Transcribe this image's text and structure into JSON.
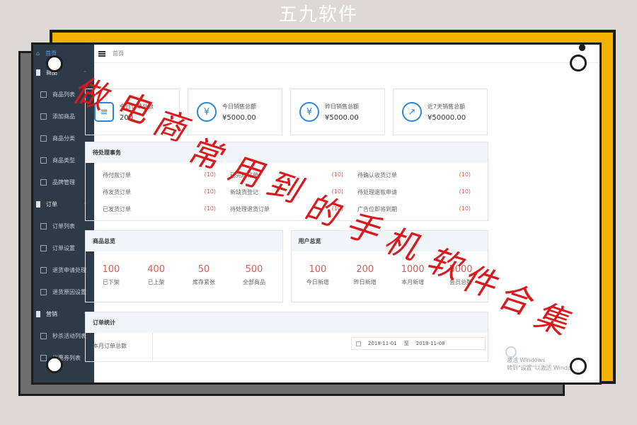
{
  "brand": "五九软件",
  "banner": "做电商常用到的手机软件合集",
  "topbar": {
    "breadcrumb": "首页"
  },
  "sidebar": {
    "home": "首页",
    "items": [
      {
        "kind": "group",
        "label": "商品"
      },
      {
        "kind": "item",
        "label": "商品列表"
      },
      {
        "kind": "item",
        "label": "添加商品"
      },
      {
        "kind": "item",
        "label": "商品分类"
      },
      {
        "kind": "item",
        "label": "商品类型"
      },
      {
        "kind": "item",
        "label": "品牌管理"
      },
      {
        "kind": "group",
        "label": "订单"
      },
      {
        "kind": "item",
        "label": "订单列表"
      },
      {
        "kind": "item",
        "label": "订单设置"
      },
      {
        "kind": "item",
        "label": "退货申请处理"
      },
      {
        "kind": "item",
        "label": "退货原因设置"
      },
      {
        "kind": "group",
        "label": "营销"
      },
      {
        "kind": "item",
        "label": "秒杀活动列表"
      },
      {
        "kind": "item",
        "label": "优惠券列表"
      }
    ]
  },
  "cards": [
    {
      "icon": "clipboard-icon",
      "glyph": "≡",
      "title": "今日订单总数",
      "value": "200"
    },
    {
      "icon": "yen-icon",
      "glyph": "¥",
      "title": "今日销售总额",
      "value": "¥5000.00"
    },
    {
      "icon": "coins-icon",
      "glyph": "¥",
      "title": "昨日销售总额",
      "value": "¥5000.00"
    },
    {
      "icon": "trend-chart-icon",
      "glyph": "↗",
      "title": "近7天销售总额",
      "value": "¥50000.00"
    }
  ],
  "pending": {
    "title": "待处理事务",
    "items": [
      {
        "label": "待付款订单",
        "count": "(10)"
      },
      {
        "label": "已完成订单",
        "count": "(10)"
      },
      {
        "label": "待确认收货订单",
        "count": "(10)"
      },
      {
        "label": "待发货订单",
        "count": "(10)"
      },
      {
        "label": "新缺货登记",
        "count": "(10)"
      },
      {
        "label": "待处理退款申请",
        "count": "(10)"
      },
      {
        "label": "已发货订单",
        "count": "(10)"
      },
      {
        "label": "待处理退货订单",
        "count": "(10)"
      },
      {
        "label": "广告位即将到期",
        "count": "(10)"
      }
    ]
  },
  "goods_overview": {
    "title": "商品总览",
    "stats": [
      {
        "num": "100",
        "label": "已下架"
      },
      {
        "num": "400",
        "label": "已上架"
      },
      {
        "num": "50",
        "label": "库存紧张"
      },
      {
        "num": "500",
        "label": "全部商品"
      }
    ]
  },
  "user_overview": {
    "title": "用户总览",
    "stats": [
      {
        "num": "100",
        "label": "今日新增"
      },
      {
        "num": "200",
        "label": "昨日新增"
      },
      {
        "num": "1000",
        "label": "本月新增"
      },
      {
        "num": "5000",
        "label": "会员总数"
      }
    ]
  },
  "order_stats": {
    "title": "订单统计",
    "row_label": "本月订单总数",
    "date_start": "2018-11-01",
    "date_sep": "至",
    "date_end": "2018-11-08"
  },
  "watermark": {
    "line1": "激活 Windows",
    "line2": "转到\"设置\"以激活 Windows。"
  },
  "colors": {
    "yellow": "#f2b100",
    "sidebar": "#2d3a47",
    "accent": "#2d86d8",
    "count_red": "#e05a5a",
    "banner_red": "#d9191c"
  }
}
